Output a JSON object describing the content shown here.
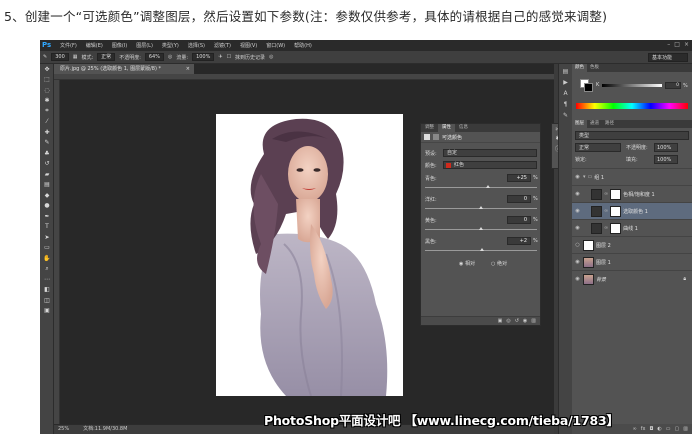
{
  "caption": "5、创建一个“可选颜色”调整图层，然后设置如下参数(注：参数仅供参考，具体的请根据自己的感觉来调整)",
  "app": {
    "logo": "Ps",
    "menu": [
      "文件(F)",
      "编辑(E)",
      "图像(I)",
      "图层(L)",
      "类型(Y)",
      "选择(S)",
      "滤镜(T)",
      "视图(V)",
      "窗口(W)",
      "帮助(H)"
    ],
    "window_controls": [
      "–",
      "□",
      "×"
    ]
  },
  "options_bar": {
    "brush_size": "300",
    "mode_label": "模式:",
    "mode_value": "正常",
    "opacity_label": "不透明度:",
    "opacity_value": "64%",
    "flow_label": "流量:",
    "flow_value": "100%",
    "history_label": "抹到历史记录",
    "workspace": "基本功能"
  },
  "document": {
    "tab_title": "原片.jpg @ 25% (选取颜色 1, 图层蒙版/8) *",
    "tab_close": "×",
    "status_zoom": "25%",
    "status_doc": "文档:11.9M/30.8M"
  },
  "watermark": "PhotoShop平面设计吧 【www.linecg.com/tieba/1783】",
  "properties": {
    "tabs": [
      "调整",
      "属性",
      "信息"
    ],
    "title": "可选颜色",
    "preset_label": "预设:",
    "preset_value": "自定",
    "colors_label": "颜色:",
    "colors_value": "红色",
    "sliders": [
      {
        "label": "青色:",
        "value": "+25",
        "fraction": 0.56
      },
      {
        "label": "洋红:",
        "value": "0",
        "fraction": 0.5
      },
      {
        "label": "黄色:",
        "value": "0",
        "fraction": 0.5
      },
      {
        "label": "黑色:",
        "value": "+2",
        "fraction": 0.51
      }
    ],
    "pct": "%",
    "method_relative": "相对",
    "method_absolute": "绝对"
  },
  "color_panel": {
    "tabs": [
      "颜色",
      "色板"
    ],
    "channel": "K",
    "value": "0",
    "unit": "%"
  },
  "layers_panel": {
    "tabs": [
      "图层",
      "通道",
      "路径"
    ],
    "filter": "类型",
    "blend_mode": "正常",
    "opacity_label": "不透明度:",
    "opacity_value": "100%",
    "lock_label": "锁定:",
    "fill_label": "填充:",
    "fill_value": "100%",
    "layers": [
      {
        "name": "组 1",
        "thumb": "folder"
      },
      {
        "name": "色相/饱和度 1",
        "thumb": "mask"
      },
      {
        "name": "选取颜色 1",
        "thumb": "mask"
      },
      {
        "name": "曲线 1",
        "thumb": "mask"
      },
      {
        "name": "图层 2",
        "thumb": "white"
      },
      {
        "name": "图层 1",
        "thumb": "photo"
      },
      {
        "name": "背景",
        "thumb": "photo"
      }
    ]
  },
  "colors": {
    "ps_blue": "#31a8ff",
    "selected_layer": "#5e6b7e",
    "workspace_bg": "#282828"
  }
}
